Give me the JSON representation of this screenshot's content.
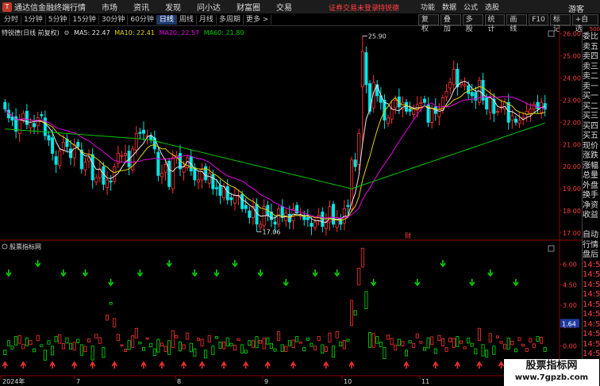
{
  "app": {
    "title": "通达信金融终端",
    "logo": "T"
  },
  "main_menu": [
    "行情",
    "市场",
    "资讯",
    "发现",
    "问小达",
    "财富圈",
    "交易"
  ],
  "login_warning": "证券交易未登录",
  "stock_tag": "特锐德",
  "right_menu": [
    "功能",
    "数据",
    "公式",
    "选股"
  ],
  "guest_label": "游客",
  "period_tabs": [
    "分时",
    "1分钟",
    "5分钟",
    "15分钟",
    "30分钟",
    "60分钟",
    "日线",
    "周线",
    "月线",
    "多周期",
    "更多 >"
  ],
  "active_period": "日线",
  "tool_buttons": [
    "复权",
    "叠加",
    "多股",
    "统计",
    "画线",
    "F10",
    "标记",
    "+自选"
  ],
  "main_legend": {
    "title": "特锐德(日线 前复权)",
    "ma5": "MA5: 22.47",
    "ma10": "MA10: 22.41",
    "ma20": "MA20: 22.57",
    "ma60": "MA60: 21.80"
  },
  "colors": {
    "up": "#ff3232",
    "down": "#00e5e5",
    "ma5": "#e6e6e6",
    "ma10": "#e6d200",
    "ma20": "#e600e6",
    "ma60": "#00c800",
    "indicator_up": "#ff3232",
    "indicator_down": "#00e100"
  },
  "chart_data": [
    {
      "type": "candlestick",
      "title": "特锐德(日线 前复权)",
      "y_ticks": [
        "26.00",
        "25.00",
        "24.00",
        "23.00",
        "22.00",
        "21.00",
        "20.00",
        "19.00",
        "18.00",
        "17.00"
      ],
      "ylim": [
        16.75,
        26.2
      ],
      "annotations": [
        {
          "text": "25.90",
          "x": 127,
          "y": 25.9
        },
        {
          "text": "17.06",
          "x": 91,
          "y": 17.06
        },
        {
          "text": "财",
          "x": 147,
          "y": 16.9
        }
      ],
      "ma_labels": [
        "MA5",
        "MA10",
        "MA20",
        "MA60"
      ],
      "closes": [
        22.6,
        22.2,
        22.1,
        21.6,
        22.1,
        22.4,
        21.9,
        22.0,
        21.8,
        22.2,
        22.3,
        21.4,
        21.2,
        20.6,
        20.1,
        20.7,
        21.1,
        20.9,
        20.4,
        21.0,
        20.9,
        19.9,
        20.2,
        20.4,
        19.4,
        19.5,
        19.9,
        19.2,
        19.4,
        19.3,
        20.0,
        20.6,
        20.5,
        20.6,
        20.0,
        20.8,
        21.5,
        21.5,
        21.5,
        21.4,
        21.2,
        20.8,
        19.6,
        19.7,
        20.1,
        19.1,
        20.4,
        20.5,
        19.9,
        20.0,
        20.4,
        19.8,
        19.4,
        19.4,
        19.9,
        19.4,
        19.7,
        19.0,
        19.0,
        18.7,
        19.1,
        18.5,
        18.5,
        18.7,
        18.7,
        18.1,
        18.1,
        17.7,
        18.2,
        17.4,
        17.4,
        18.2,
        17.8,
        17.6,
        17.4,
        18.1,
        17.7,
        17.9,
        17.5,
        18.1,
        17.9,
        17.8,
        17.6,
        17.6,
        17.3,
        17.5,
        17.8,
        17.3,
        17.5,
        18.2,
        17.4,
        17.7,
        17.4,
        18.1,
        18.2,
        20.3,
        20.0,
        21.5,
        25.2,
        23.7,
        22.5,
        23.8,
        23.2,
        22.9,
        22.1,
        22.2,
        22.6,
        23.0,
        22.7,
        22.9,
        22.5,
        22.5,
        22.6,
        22.8,
        22.9,
        22.9,
        22.0,
        22.6,
        22.4,
        22.6,
        23.1,
        23.4,
        23.8,
        24.4,
        23.6,
        23.8,
        23.7,
        23.3,
        23.2,
        23.0,
        23.9,
        23.0,
        22.6,
        23.1,
        22.4,
        22.5,
        22.7,
        22.9,
        22.0,
        22.3,
        22.0,
        22.1,
        22.2,
        22.5,
        22.6,
        22.8,
        22.6,
        22.9,
        22.6
      ],
      "change_labels": [
        "2024年",
        "7",
        "8",
        "9",
        "10",
        "11",
        "12"
      ]
    },
    {
      "type": "indicator",
      "title": "股票指标网",
      "y_ticks": [
        "6.00",
        "4.50",
        "3.00",
        "1.50",
        "0.00",
        "-1.50"
      ],
      "ylim": [
        -2.0,
        6.9
      ],
      "current_value": "1.64"
    }
  ],
  "right_panel": [
    "委比",
    "卖五",
    "卖四",
    "卖三",
    "卖二",
    "卖一",
    "买一",
    "买二",
    "买三",
    "买四",
    "买五",
    "现价",
    "涨跌",
    "涨幅",
    "总量",
    "外盘",
    "换手",
    "净资",
    "收益",
    "",
    "自动",
    "行情",
    "盘后",
    "14:50",
    "14:50",
    "14:50",
    "14:50",
    "14:50",
    "14:50",
    "14:50",
    "14:50",
    "14:50",
    "14:50"
  ],
  "watermark": {
    "line1": "股票指标网",
    "line2": "www.7gpzb.com"
  },
  "panel_caption": "500"
}
